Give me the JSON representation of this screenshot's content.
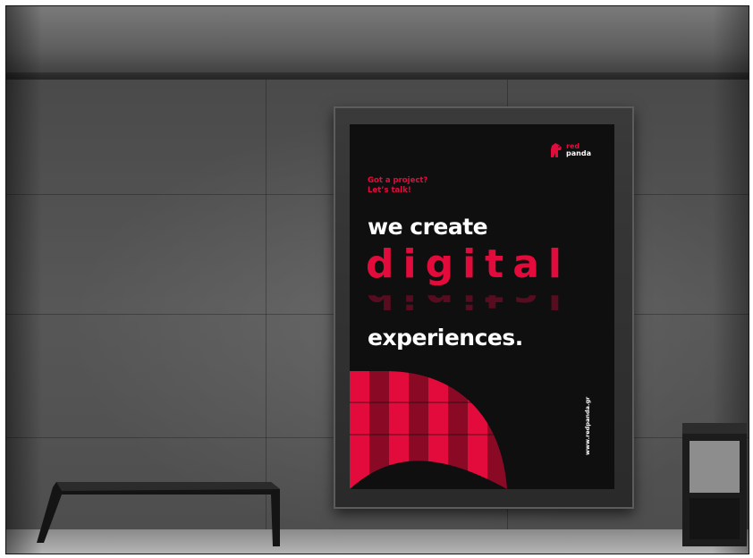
{
  "poster": {
    "logo": {
      "line1": "red",
      "line2": "panda"
    },
    "tagline": {
      "line1": "Got a project?",
      "line2": "Let’s talk!"
    },
    "headline": {
      "line1": "we create",
      "line2": "digital",
      "line3": "experiences."
    },
    "website": "www.redpanda.gr"
  },
  "colors": {
    "brand_red": "#e30b3c",
    "dark_red": "#8a0a25",
    "poster_bg": "#0f0f10"
  },
  "icons": {
    "logo": "red-panda-icon"
  }
}
